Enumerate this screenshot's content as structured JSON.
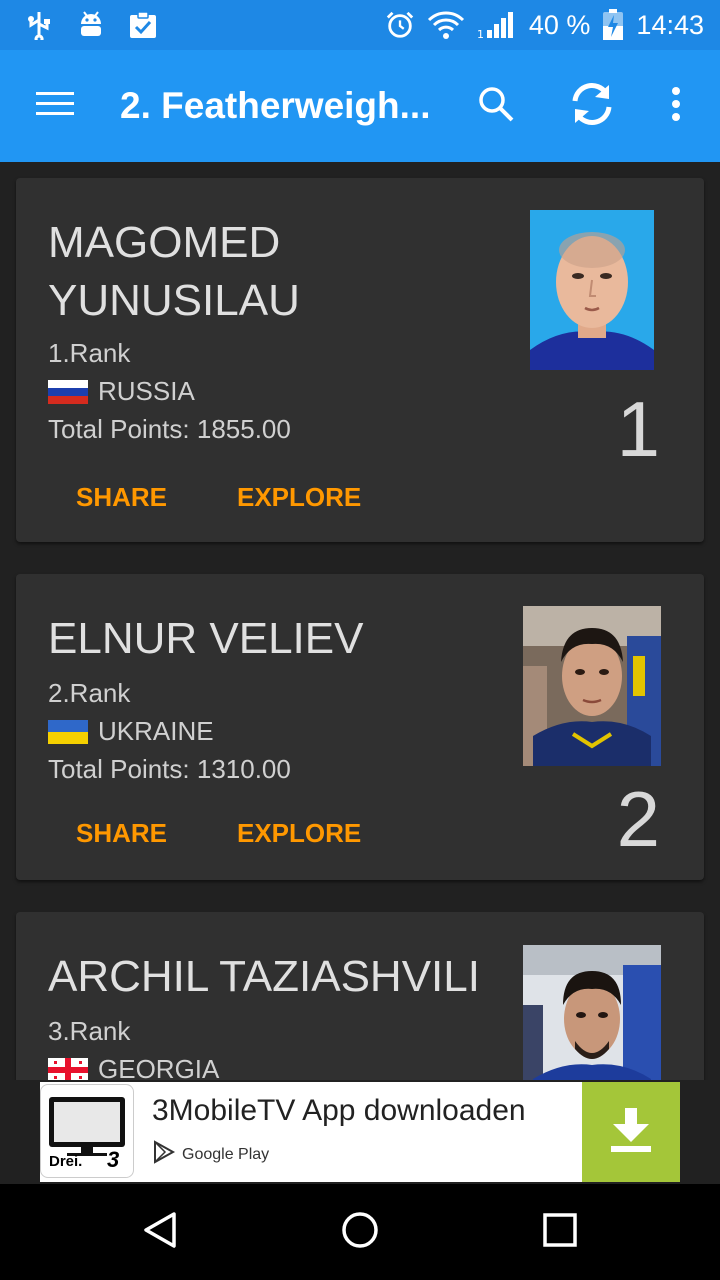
{
  "status_bar": {
    "battery": "40 %",
    "time": "14:43"
  },
  "toolbar": {
    "title": "2. Featherweigh..."
  },
  "cards": [
    {
      "name": "MAGOMED YUNUSILAU",
      "rank": "1.Rank",
      "country": "RUSSIA",
      "points": "Total Points: 1855.00",
      "number": "1",
      "share": "SHARE",
      "explore": "EXPLORE"
    },
    {
      "name": "ELNUR VELIEV",
      "rank": "2.Rank",
      "country": "UKRAINE",
      "points": "Total Points: 1310.00",
      "number": "2",
      "share": "SHARE",
      "explore": "EXPLORE"
    },
    {
      "name": "ARCHIL TAZIASHVILI",
      "rank": "3.Rank",
      "country": "GEORGIA"
    }
  ],
  "ad": {
    "title": "3MobileTV App downloaden",
    "store": "Google Play",
    "logo_text": "Drei.",
    "logo_num": "3"
  },
  "colors": {
    "status_bar": "#1e88e5",
    "toolbar": "#2196f3",
    "accent": "#ff9800",
    "card": "#303030",
    "background": "#212121"
  }
}
